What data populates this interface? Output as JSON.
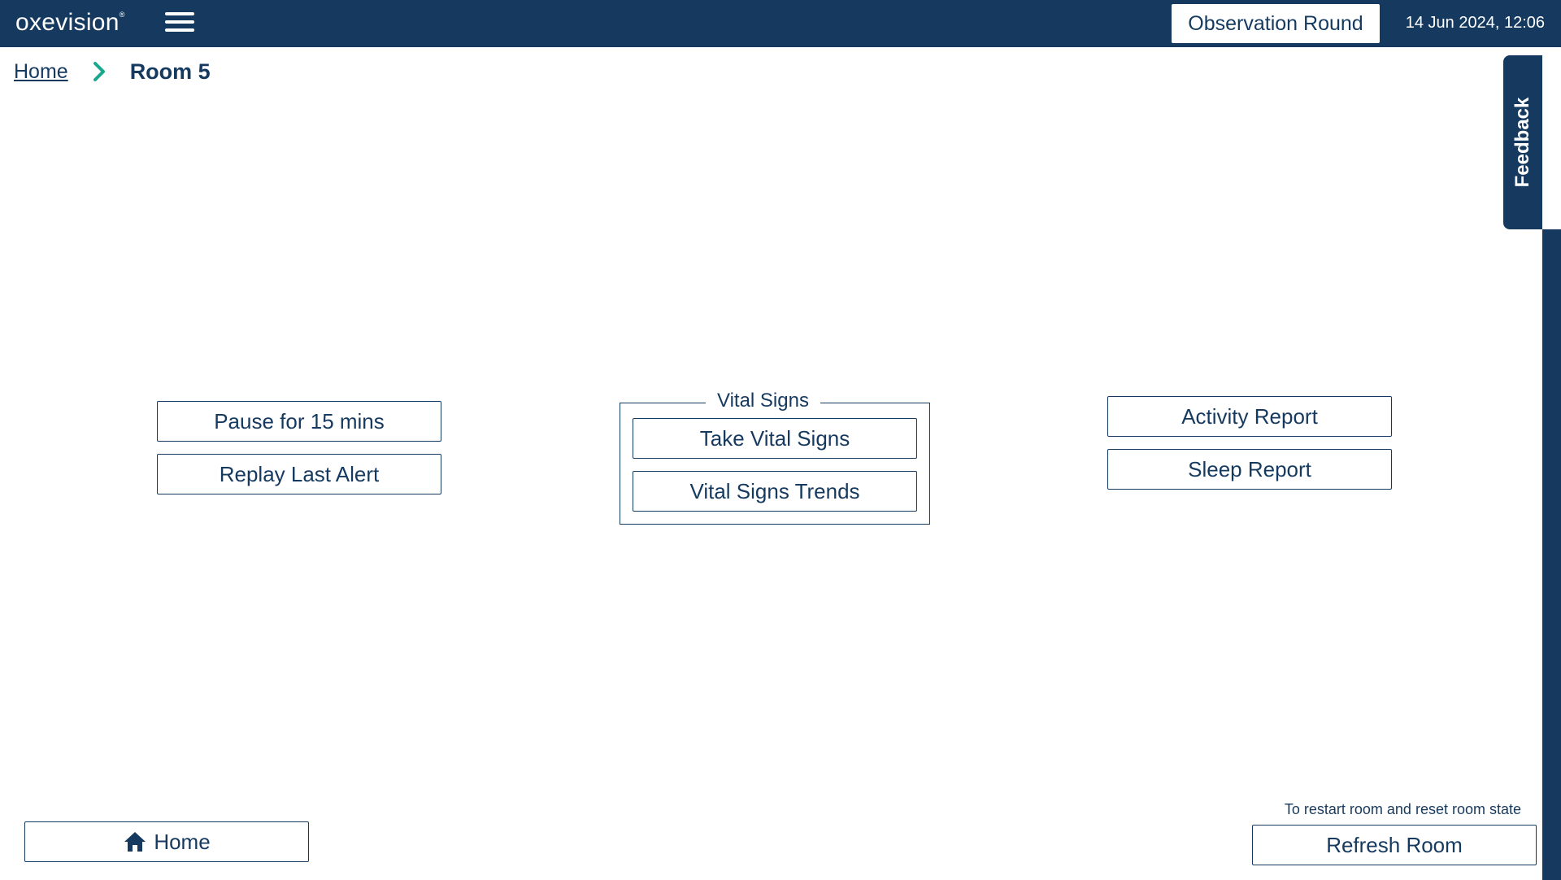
{
  "header": {
    "logo_text": "oxevision",
    "logo_mark": "®",
    "observation_button_label": "Observation Round",
    "datetime": "14 Jun 2024, 12:06"
  },
  "breadcrumb": {
    "home_label": "Home",
    "current_label": "Room 5"
  },
  "feedback_label": "Feedback",
  "left_actions": {
    "pause_label": "Pause for 15 mins",
    "replay_label": "Replay Last Alert"
  },
  "vital_signs": {
    "legend": "Vital Signs",
    "take_label": "Take Vital Signs",
    "trends_label": "Vital Signs Trends"
  },
  "right_actions": {
    "activity_label": "Activity Report",
    "sleep_label": "Sleep Report"
  },
  "footer": {
    "home_label": "Home",
    "restart_note": "To restart room and reset room state",
    "refresh_label": "Refresh Room"
  },
  "icons": {
    "menu": "hamburger-menu-icon",
    "chevron": "chevron-right-icon",
    "home": "home-icon"
  },
  "colors": {
    "brand_navy": "#163a5f",
    "accent_teal": "#19a88f",
    "background": "#ffffff"
  }
}
